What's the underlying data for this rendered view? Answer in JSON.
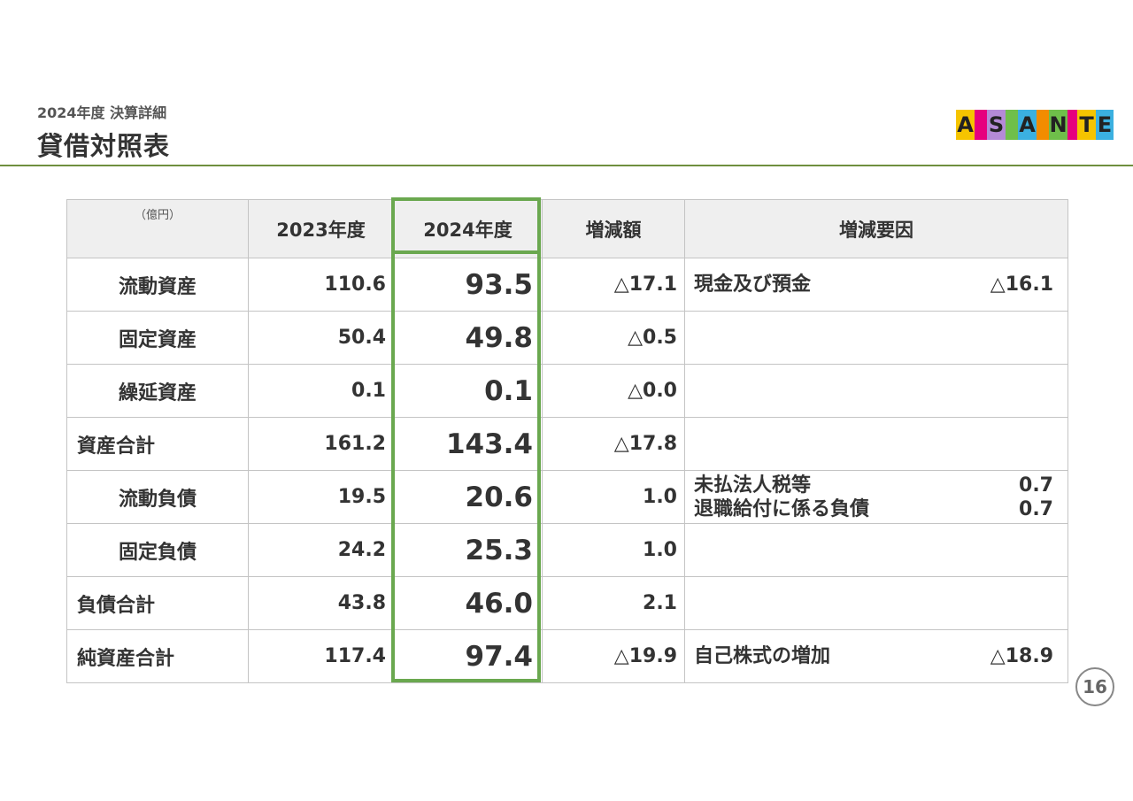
{
  "header": {
    "subtitle": "2024年度 決算詳細",
    "title": "貸借対照表"
  },
  "logo": {
    "letters": [
      "A",
      "S",
      "A",
      "N",
      "T",
      "E"
    ],
    "colors": [
      "#f5c400",
      "#9b59b6",
      "#6fbf4a",
      "#e6007e",
      "#3bb0e0",
      "#f28c00",
      "#e6007e",
      "#6fbf4a"
    ]
  },
  "table": {
    "unit": "（億円）",
    "columns": [
      "2023年度",
      "2024年度",
      "増減額",
      "増減要因"
    ],
    "rows": [
      {
        "label": "流動資産",
        "indent": true,
        "y2023": "110.6",
        "y2024": "93.5",
        "diff": "△17.1",
        "reasons": [
          {
            "text": "現金及び預金",
            "value": "△16.1"
          }
        ]
      },
      {
        "label": "固定資産",
        "indent": true,
        "y2023": "50.4",
        "y2024": "49.8",
        "diff": "△0.5",
        "reasons": []
      },
      {
        "label": "繰延資産",
        "indent": true,
        "y2023": "0.1",
        "y2024": "0.1",
        "diff": "△0.0",
        "reasons": []
      },
      {
        "label": "資産合計",
        "indent": false,
        "y2023": "161.2",
        "y2024": "143.4",
        "diff": "△17.8",
        "reasons": []
      },
      {
        "label": "流動負債",
        "indent": true,
        "y2023": "19.5",
        "y2024": "20.6",
        "diff": "1.0",
        "reasons": [
          {
            "text": "未払法人税等",
            "value": "0.7"
          },
          {
            "text": "退職給付に係る負債",
            "value": "0.7"
          }
        ]
      },
      {
        "label": "固定負債",
        "indent": true,
        "y2023": "24.2",
        "y2024": "25.3",
        "diff": "1.0",
        "reasons": []
      },
      {
        "label": "負債合計",
        "indent": false,
        "y2023": "43.8",
        "y2024": "46.0",
        "diff": "2.1",
        "reasons": []
      },
      {
        "label": "純資産合計",
        "indent": false,
        "y2023": "117.4",
        "y2024": "97.4",
        "diff": "△19.9",
        "reasons": [
          {
            "text": "自己株式の増加",
            "value": "△18.9"
          }
        ]
      }
    ]
  },
  "highlight_color": "#6aa84f",
  "page_number": "16"
}
